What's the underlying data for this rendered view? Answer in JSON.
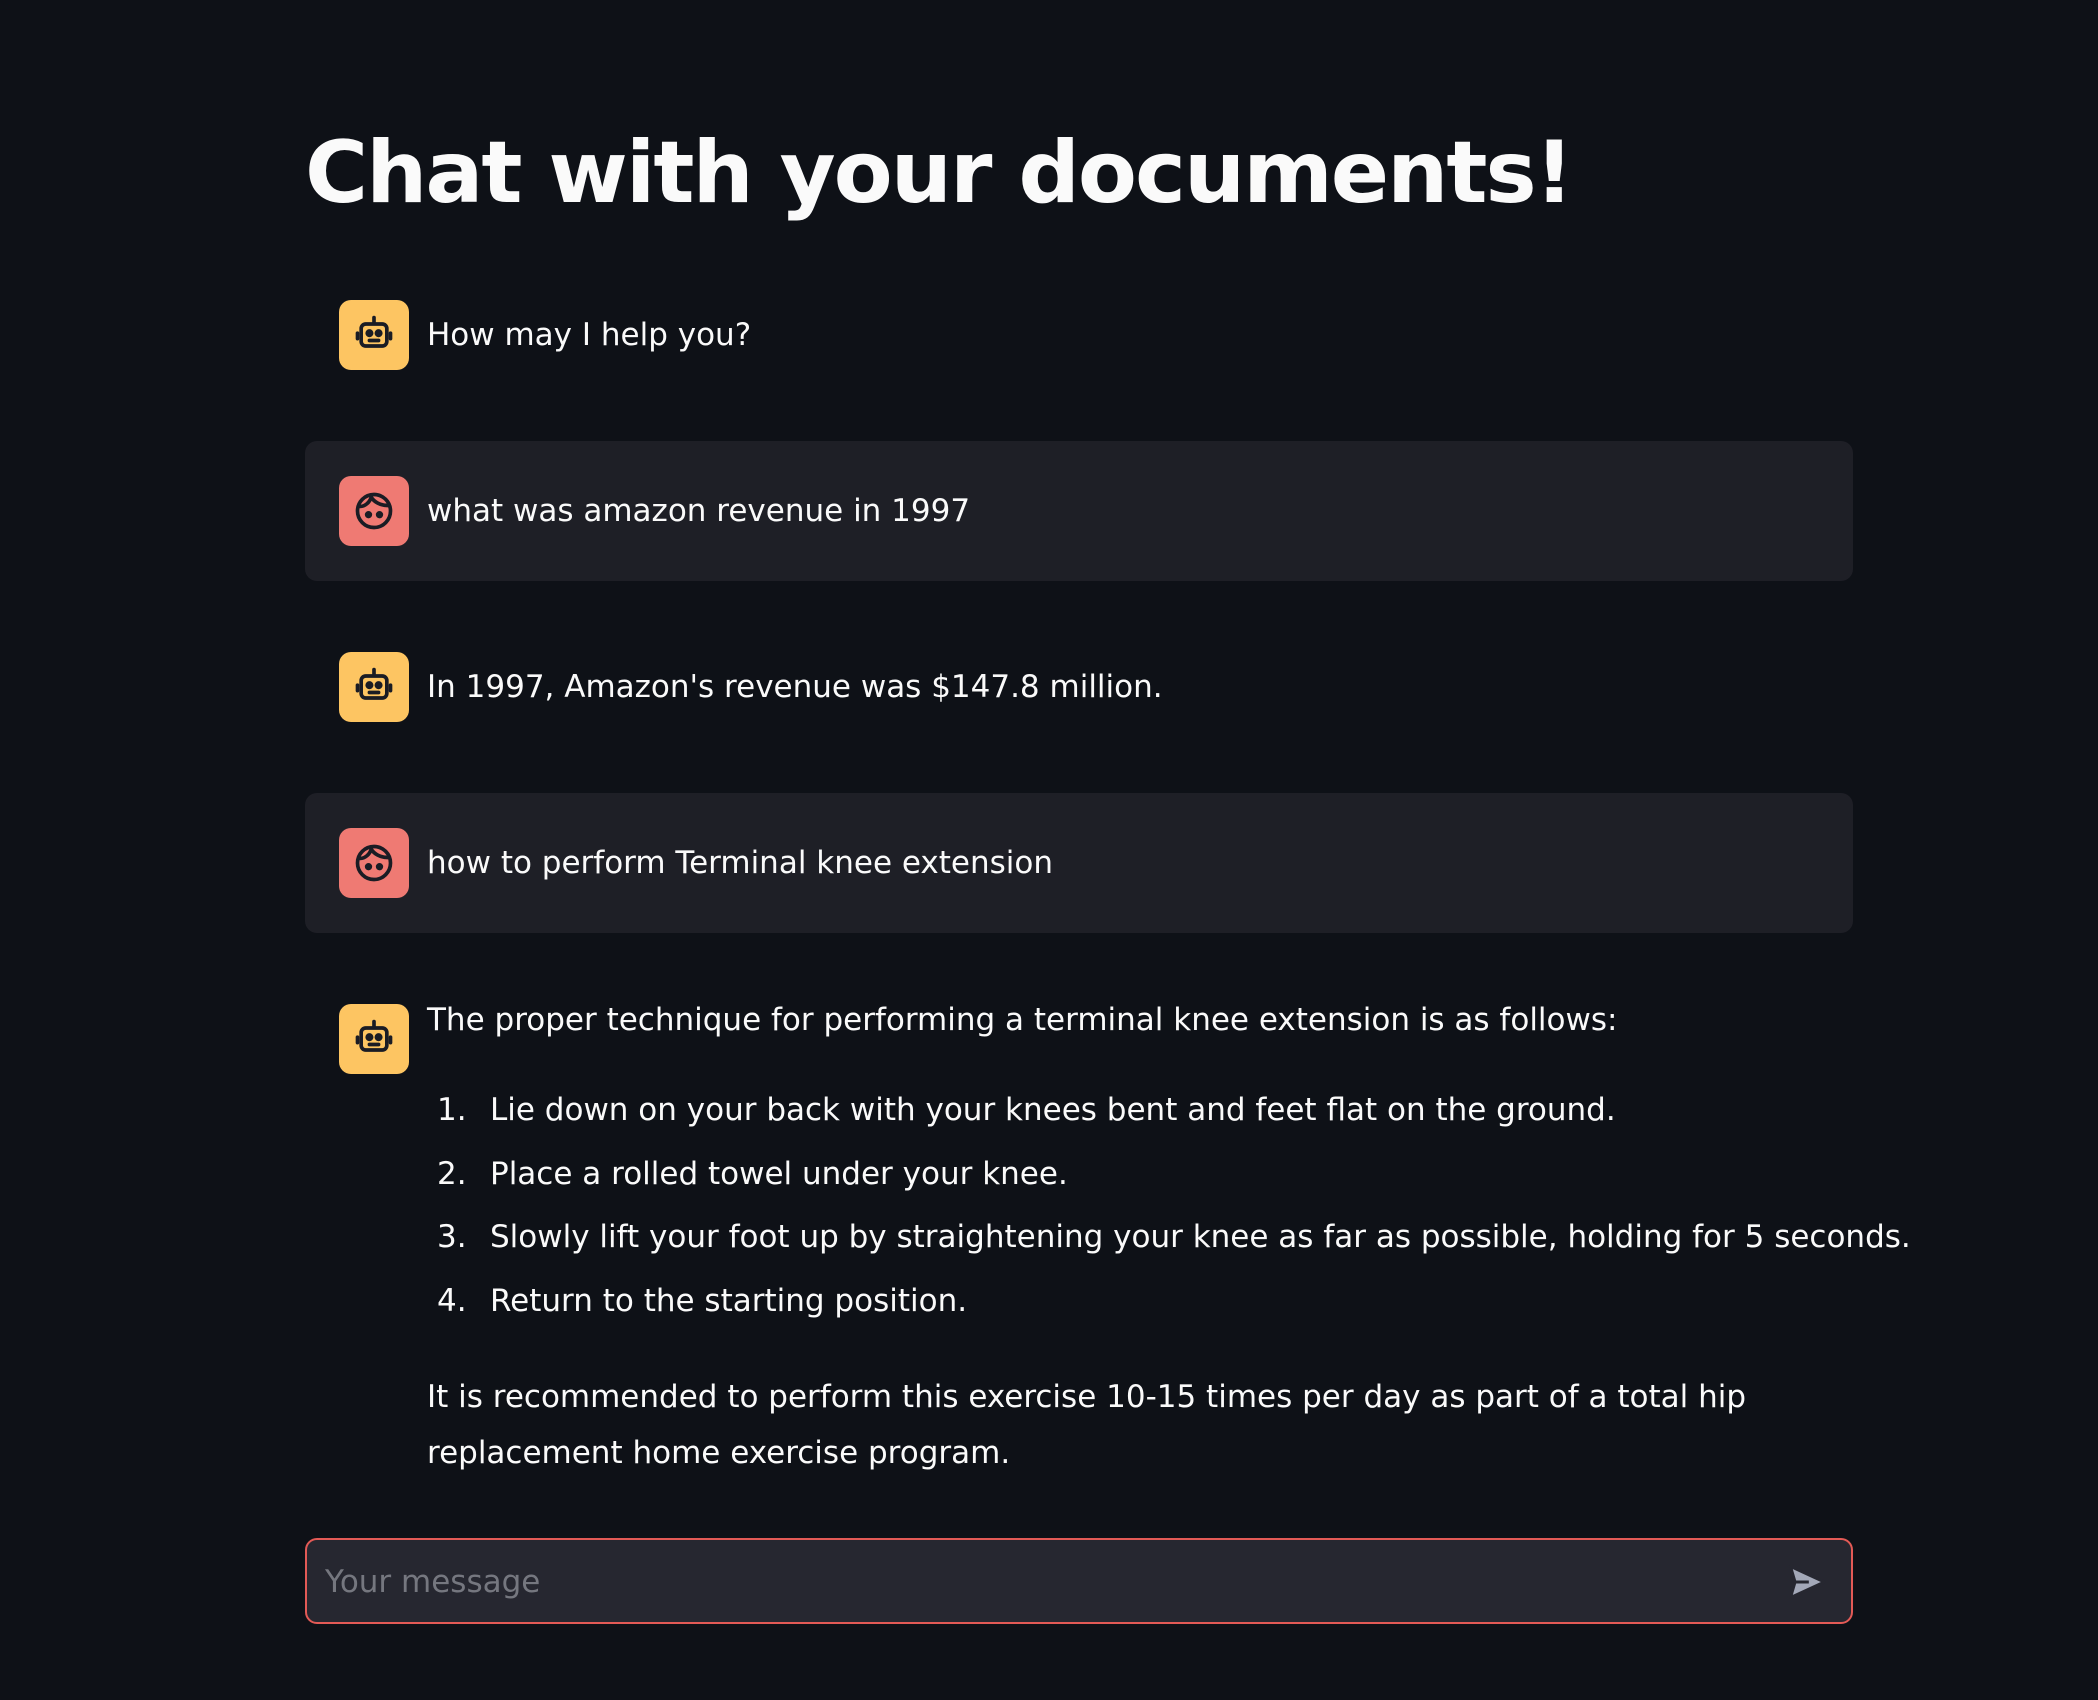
{
  "page": {
    "title": "Chat with your documents!"
  },
  "messages": [
    {
      "role": "assistant",
      "avatar_icon": "robot-icon",
      "text": "How may I help you?"
    },
    {
      "role": "user",
      "avatar_icon": "user-face-icon",
      "text": "what was amazon revenue in 1997"
    },
    {
      "role": "assistant",
      "avatar_icon": "robot-icon",
      "text": "In 1997, Amazon's revenue was $147.8 million."
    },
    {
      "role": "user",
      "avatar_icon": "user-face-icon",
      "text": "how to perform Terminal knee extension"
    },
    {
      "role": "assistant",
      "avatar_icon": "robot-icon",
      "intro": "The proper technique for performing a terminal knee extension is as follows:",
      "steps": [
        {
          "num": "1.",
          "text": "Lie down on your back with your knees bent and feet flat on the ground."
        },
        {
          "num": "2.",
          "text": "Place a rolled towel under your knee."
        },
        {
          "num": "3.",
          "text": "Slowly lift your foot up by straightening your knee as far as possible, holding for 5 seconds."
        },
        {
          "num": "4.",
          "text": "Return to the starting position."
        }
      ],
      "outro": "It is recommended to perform this exercise 10-15 times per day as part of a total hip replacement home exercise program."
    }
  ],
  "chat_input": {
    "placeholder": "Your message",
    "value": "",
    "send_icon": "send-icon"
  },
  "colors": {
    "background": "#0e1117",
    "user_message_bg": "#1e1f26",
    "assistant_avatar": "#fdc562",
    "user_avatar": "#ef7a73",
    "input_border": "#e35a56",
    "input_bg": "#262730"
  }
}
